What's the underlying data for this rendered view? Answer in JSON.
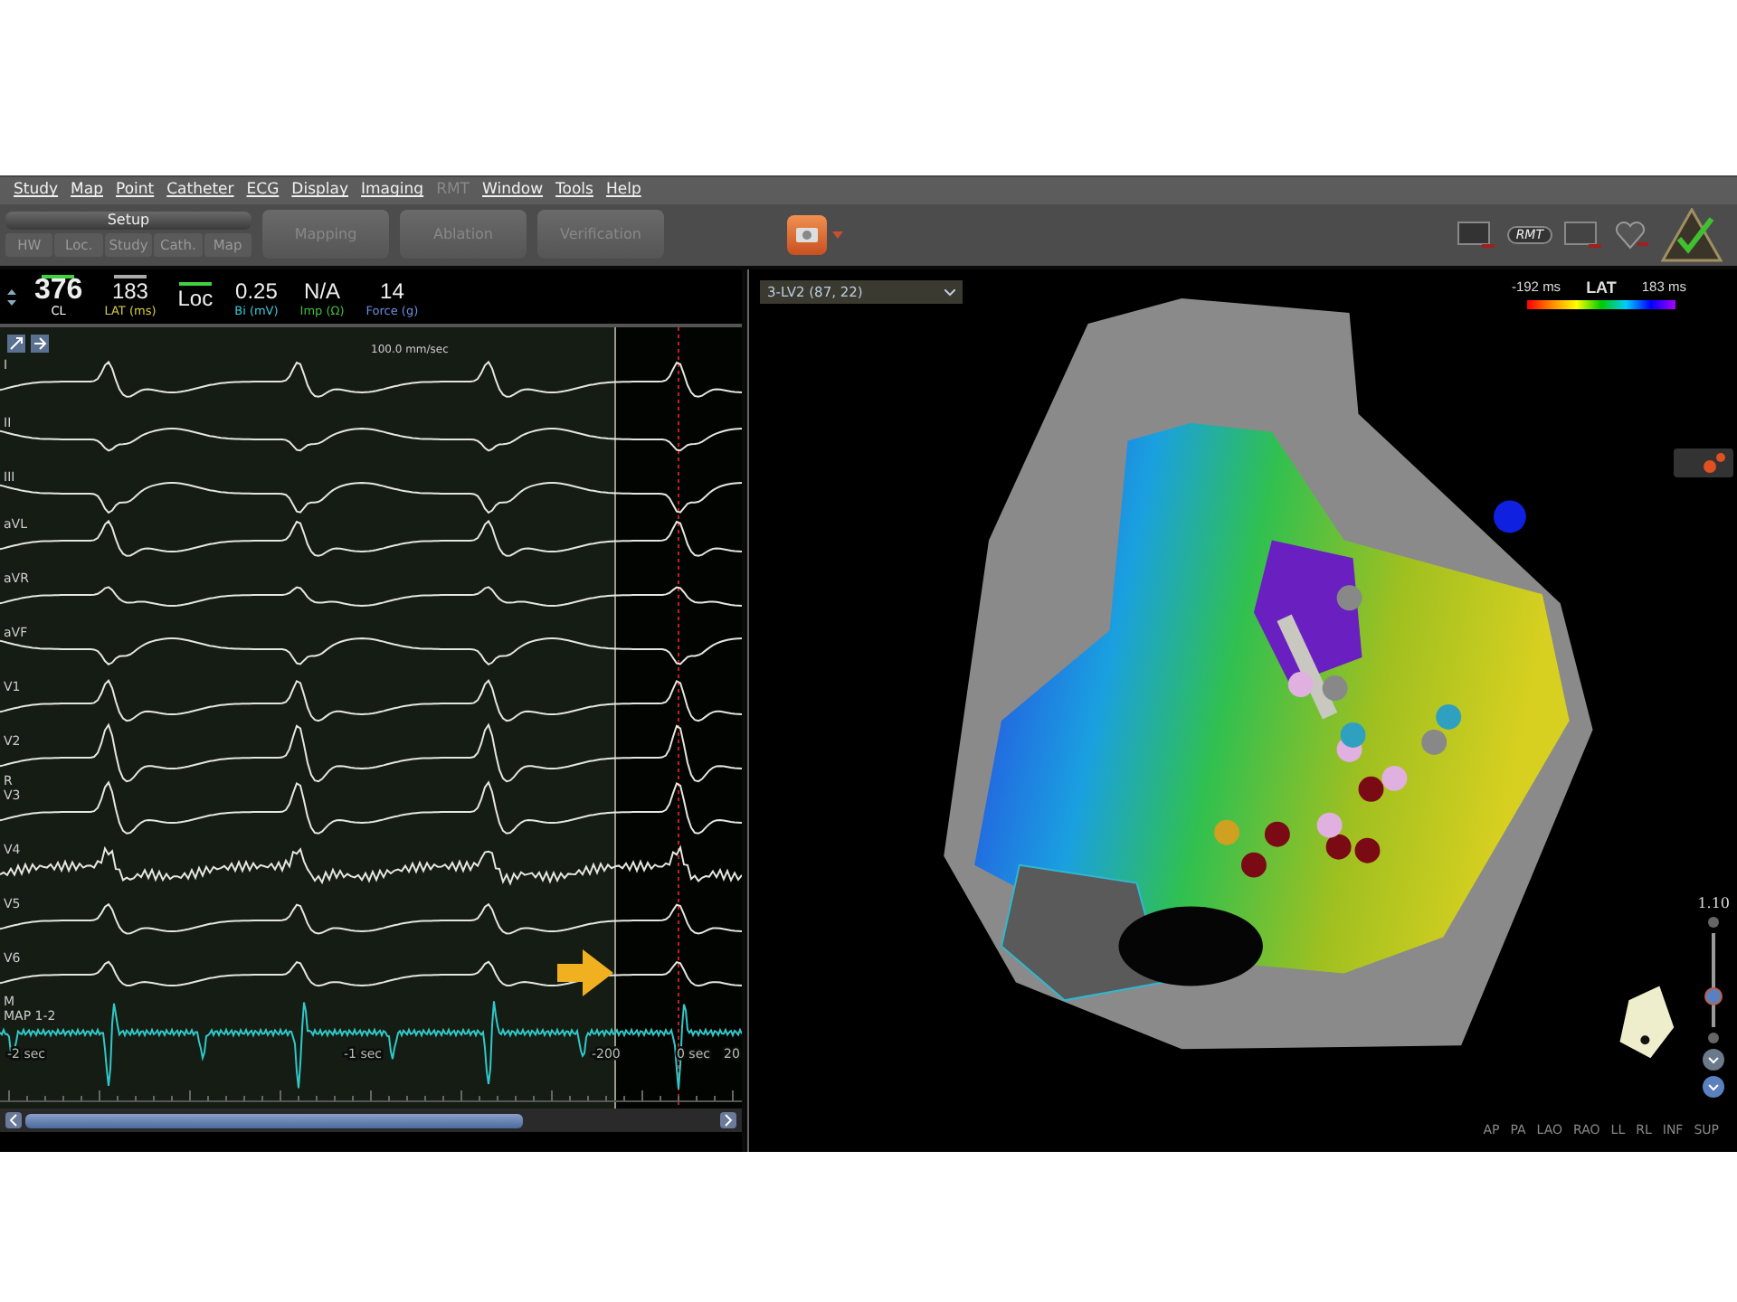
{
  "menu": [
    {
      "label": "Study",
      "disabled": false
    },
    {
      "label": "Map",
      "disabled": false
    },
    {
      "label": "Point",
      "disabled": false
    },
    {
      "label": "Catheter",
      "disabled": false
    },
    {
      "label": "ECG",
      "disabled": false
    },
    {
      "label": "Display",
      "disabled": false
    },
    {
      "label": "Imaging",
      "disabled": false
    },
    {
      "label": "RMT",
      "disabled": true
    },
    {
      "label": "Window",
      "disabled": false
    },
    {
      "label": "Tools",
      "disabled": false
    },
    {
      "label": "Help",
      "disabled": false
    }
  ],
  "toolbar": {
    "setup": {
      "label": "Setup",
      "tabs": [
        "HW",
        "Loc.",
        "Study",
        "Cath.",
        "Map"
      ]
    },
    "stages": [
      "Mapping",
      "Ablation",
      "Verification"
    ],
    "rmt_badge": "RMT"
  },
  "readouts": [
    {
      "value": "376",
      "label": "CL",
      "color": "#ffffff",
      "indicator": true
    },
    {
      "value": "183",
      "label": "LAT (ms)",
      "color": "#d8d040",
      "indicator": false
    },
    {
      "value": "Loc",
      "indicator": true
    },
    {
      "value": "0.25",
      "label": "Bi (mV)",
      "color": "#40c8d8"
    },
    {
      "value": "N/A",
      "label": "Imp (Ω)",
      "color": "#40c040"
    },
    {
      "value": "14",
      "label": "Force (g)",
      "color": "#6a8ee0"
    }
  ],
  "ecg": {
    "speed": "100.0 mm/sec",
    "leads": [
      {
        "label": "I"
      },
      {
        "label": "II"
      },
      {
        "label": "III"
      },
      {
        "label": "aVL"
      },
      {
        "label": "aVR"
      },
      {
        "label": "aVF"
      },
      {
        "label": "V1"
      },
      {
        "label": "V2"
      },
      {
        "label": "V3",
        "tag": "R"
      },
      {
        "label": "V4"
      },
      {
        "label": "V5"
      },
      {
        "label": "V6"
      },
      {
        "label": "MAP 1-2",
        "tag": "M"
      }
    ],
    "time_labels": [
      "-2 sec",
      "-1 sec",
      "-200",
      "0 sec",
      "20"
    ]
  },
  "map": {
    "selector": "3-LV2 (87, 22)",
    "legend": {
      "min": "-192 ms",
      "title": "LAT",
      "max": "183 ms"
    },
    "zoom": {
      "reading": "1.10",
      "level": 0.33
    },
    "views": [
      "AP",
      "PA",
      "LAO",
      "RAO",
      "LL",
      "RL",
      "INF",
      "SUP"
    ]
  }
}
